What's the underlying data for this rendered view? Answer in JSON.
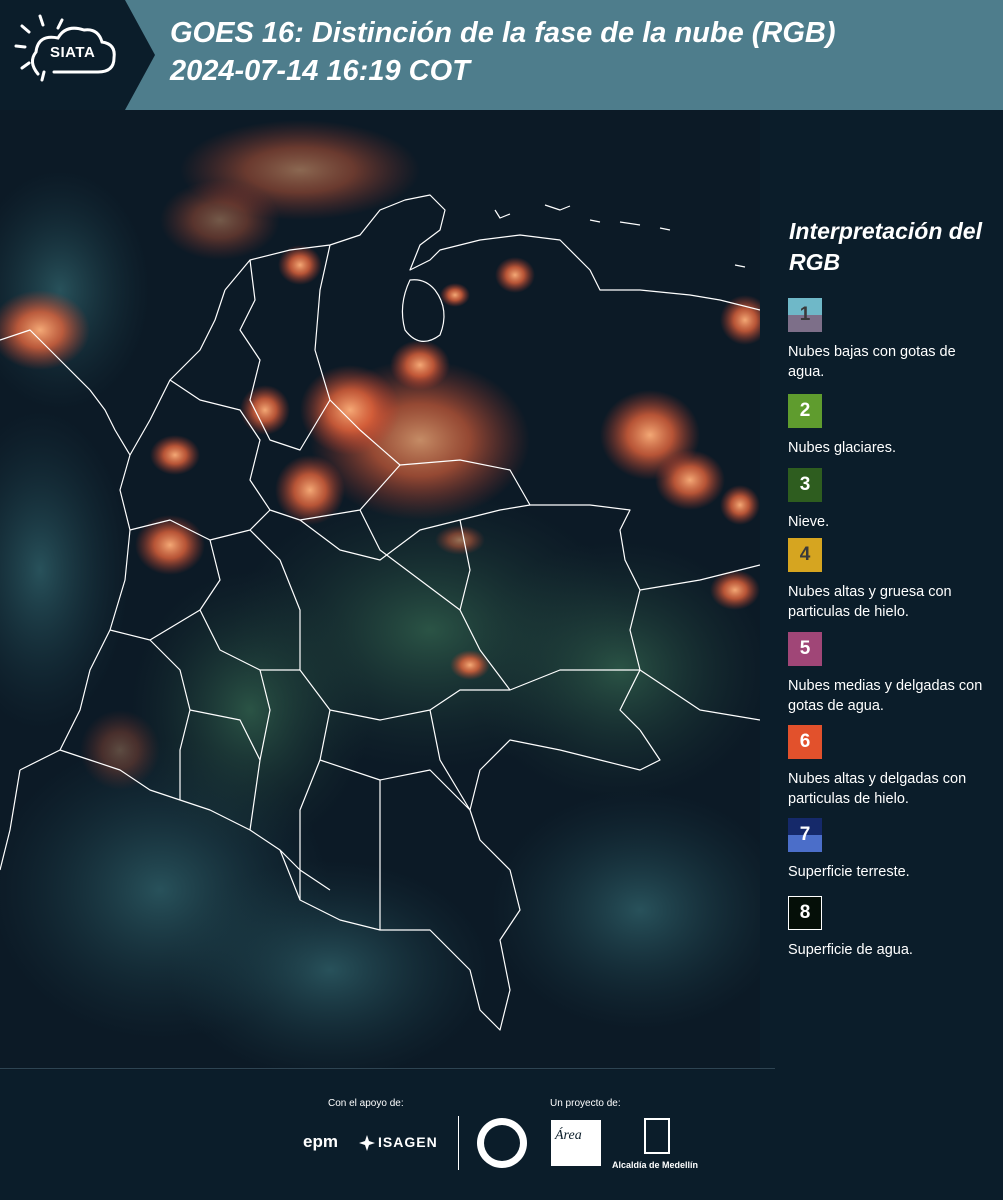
{
  "header": {
    "logo_text": "SIATA",
    "title": "GOES 16: Distinción de la fase de la nube (RGB)\n 2024-07-14 16:19 COT"
  },
  "legend": {
    "title": "Interpretación del RGB",
    "items": [
      {
        "num": "1",
        "label": "Nubes bajas con gotas de agua.",
        "top": "#6fb8c8",
        "bottom": "#7d6f89",
        "numcolor": "#3a3a3a"
      },
      {
        "num": "2",
        "label": "Nubes glaciares.",
        "top": "#5f9c2e",
        "bottom": "#5f9c2e",
        "numcolor": "#ffffff"
      },
      {
        "num": "3",
        "label": "Nieve.",
        "top": "#2e5d1f",
        "bottom": "#2e5d1f",
        "numcolor": "#ffffff"
      },
      {
        "num": "4",
        "label": "Nubes altas y gruesa con particulas de hielo.",
        "top": "#d6a520",
        "bottom": "#d6a520",
        "numcolor": "#3a3a3a"
      },
      {
        "num": "5",
        "label": "Nubes medias y delgadas con gotas de agua.",
        "top": "#a04677",
        "bottom": "#a04677",
        "numcolor": "#ffffff"
      },
      {
        "num": "6",
        "label": "Nubes altas y delgadas con particulas de hielo.",
        "top": "#e2512c",
        "bottom": "#e2512c",
        "numcolor": "#ffffff"
      },
      {
        "num": "7",
        "label": "Superficie terreste.",
        "top": "#15296a",
        "bottom": "#4b6ec9",
        "numcolor": "#ffffff"
      },
      {
        "num": "8",
        "label": "Superficie de agua.",
        "top": "#050f08",
        "bottom": "#050f08",
        "numcolor": "#ffffff"
      }
    ]
  },
  "footer": {
    "support_label": "Con el apoyo de:",
    "project_label": "Un proyecto de:",
    "epm": "epm",
    "isagen": "ISAGEN",
    "area": "Área",
    "medellin": "Alcaldía de Medellín"
  },
  "colors": {
    "header_bg": "#4e7d8c",
    "page_bg": "#0b1d2a",
    "cloud_orange": "#f07a4a",
    "border_lines": "#ffffff"
  }
}
